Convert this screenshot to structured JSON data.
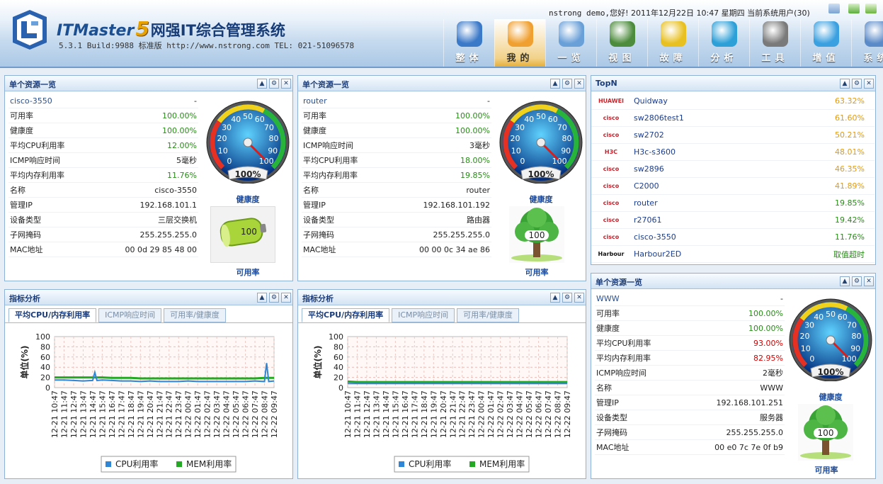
{
  "header": {
    "brand_en": "ITMaster",
    "brand_num": "5",
    "brand_cn": "网强IT综合管理系统",
    "version": "5.3.1 Build:9988",
    "edition": "标准版",
    "contact": "http://www.nstrong.com TEL: 021-51096578",
    "status_user": "nstrong demo,",
    "status_text": "您好! 2011年12月22日 10:47 星期四 当前系统用户(30)"
  },
  "nav": [
    {
      "label": "整体",
      "icon": "monitor-icon"
    },
    {
      "label": "我的",
      "icon": "user-icon",
      "active": true
    },
    {
      "label": "一览",
      "icon": "overview-icon"
    },
    {
      "label": "视图",
      "icon": "server-rack-icon"
    },
    {
      "label": "故障",
      "icon": "warning-icon"
    },
    {
      "label": "分析",
      "icon": "pie-chart-icon"
    },
    {
      "label": "工具",
      "icon": "tools-icon"
    },
    {
      "label": "增值",
      "icon": "plus-icon"
    },
    {
      "label": "系统",
      "icon": "system-icon"
    }
  ],
  "res1": {
    "title": "单个资源一览",
    "head_name": "cisco-3550",
    "head_val": "-",
    "rows": [
      {
        "k": "可用率",
        "v": "100.00%",
        "c": "g"
      },
      {
        "k": "健康度",
        "v": "100.00%",
        "c": "g"
      },
      {
        "k": "平均CPU利用率",
        "v": "12.00%",
        "c": "g"
      },
      {
        "k": "ICMP响应时间",
        "v": "5毫秒",
        "c": ""
      },
      {
        "k": "平均内存利用率",
        "v": "11.76%",
        "c": "g"
      },
      {
        "k": "名称",
        "v": "cisco-3550",
        "c": ""
      },
      {
        "k": "管理IP",
        "v": "192.168.101.1",
        "c": ""
      },
      {
        "k": "设备类型",
        "v": "三层交换机",
        "c": ""
      },
      {
        "k": "子网掩码",
        "v": "255.255.255.0",
        "c": ""
      },
      {
        "k": "MAC地址",
        "v": "00 0d 29 85 48 00",
        "c": ""
      }
    ],
    "gauge_value": 100,
    "gauge_readout": "100%",
    "gauge_caption": "健康度",
    "avail_value": "100",
    "avail_caption": "可用率"
  },
  "res2": {
    "title": "单个资源一览",
    "head_name": "router",
    "head_val": "-",
    "rows": [
      {
        "k": "可用率",
        "v": "100.00%",
        "c": "g"
      },
      {
        "k": "健康度",
        "v": "100.00%",
        "c": "g"
      },
      {
        "k": "ICMP响应时间",
        "v": "3毫秒",
        "c": ""
      },
      {
        "k": "平均CPU利用率",
        "v": "18.00%",
        "c": "g"
      },
      {
        "k": "平均内存利用率",
        "v": "19.85%",
        "c": "g"
      },
      {
        "k": "名称",
        "v": "router",
        "c": ""
      },
      {
        "k": "管理IP",
        "v": "192.168.101.192",
        "c": ""
      },
      {
        "k": "设备类型",
        "v": "路由器",
        "c": ""
      },
      {
        "k": "子网掩码",
        "v": "255.255.255.0",
        "c": ""
      },
      {
        "k": "MAC地址",
        "v": "00 00 0c 34 ae 86",
        "c": ""
      }
    ],
    "gauge_value": 100,
    "gauge_readout": "100%",
    "gauge_caption": "健康度",
    "avail_value": "100",
    "avail_caption": "可用率"
  },
  "res3": {
    "title": "单个资源一览",
    "head_name": "WWW",
    "head_val": "-",
    "rows": [
      {
        "k": "可用率",
        "v": "100.00%",
        "c": "g"
      },
      {
        "k": "健康度",
        "v": "100.00%",
        "c": "g"
      },
      {
        "k": "平均CPU利用率",
        "v": "93.00%",
        "c": "r"
      },
      {
        "k": "平均内存利用率",
        "v": "82.95%",
        "c": "r"
      },
      {
        "k": "ICMP响应时间",
        "v": "2毫秒",
        "c": ""
      },
      {
        "k": "名称",
        "v": "WWW",
        "c": ""
      },
      {
        "k": "管理IP",
        "v": "192.168.101.251",
        "c": ""
      },
      {
        "k": "设备类型",
        "v": "服务器",
        "c": ""
      },
      {
        "k": "子网掩码",
        "v": "255.255.255.0",
        "c": ""
      },
      {
        "k": "MAC地址",
        "v": "00 e0 7c 7e 0f b9",
        "c": ""
      }
    ],
    "gauge_value": 100,
    "gauge_readout": "100%",
    "gauge_caption": "健康度",
    "avail_value": "100",
    "avail_caption": "可用率"
  },
  "gauge_ticks": [
    "0",
    "10",
    "20",
    "30",
    "40",
    "50",
    "60",
    "70",
    "80",
    "90",
    "100"
  ],
  "topn": {
    "title": "TopN",
    "rows": [
      {
        "brand": "HUAWEI",
        "name": "Quidway",
        "value": "63.32%",
        "c": ""
      },
      {
        "brand": "cisco",
        "name": "sw2806test1",
        "value": "61.60%",
        "c": ""
      },
      {
        "brand": "cisco",
        "name": "sw2702",
        "value": "50.21%",
        "c": ""
      },
      {
        "brand": "H3C",
        "name": "H3c-s3600",
        "value": "48.01%",
        "c": ""
      },
      {
        "brand": "cisco",
        "name": "sw2896",
        "value": "46.35%",
        "c": ""
      },
      {
        "brand": "cisco",
        "name": "C2000",
        "value": "41.89%",
        "c": ""
      },
      {
        "brand": "cisco",
        "name": "router",
        "value": "19.85%",
        "c": "g"
      },
      {
        "brand": "cisco",
        "name": "r27061",
        "value": "19.42%",
        "c": "g"
      },
      {
        "brand": "cisco",
        "name": "cisco-3550",
        "value": "11.76%",
        "c": "g"
      },
      {
        "brand": "Harbour",
        "name": "Harbour2ED",
        "value": "取值超时",
        "c": "g"
      }
    ]
  },
  "analysis1": {
    "title": "指标分析",
    "tabs": [
      "平均CPU/内存利用率",
      "ICMP响应时间",
      "可用率/健康度"
    ]
  },
  "analysis2": {
    "title": "指标分析",
    "tabs": [
      "平均CPU/内存利用率",
      "ICMP响应时间",
      "可用率/健康度"
    ]
  },
  "chart_data": [
    {
      "type": "line",
      "ylabel": "单位(%)",
      "ylim": [
        0,
        100
      ],
      "yticks": [
        "0",
        "20",
        "40",
        "60",
        "80",
        "100"
      ],
      "grid": true,
      "legend": "bottom",
      "x": [
        "12-21 10:47",
        "12-21 11:47",
        "12-21 12:47",
        "12-21 13:47",
        "12-21 14:47",
        "12-21 15:47",
        "12-21 16:47",
        "12-21 17:47",
        "12-21 18:47",
        "12-21 19:47",
        "12-21 20:47",
        "12-21 21:47",
        "12-21 22:47",
        "12-21 23:47",
        "12-22 00:47",
        "12-22 01:47",
        "12-22 02:47",
        "12-22 03:47",
        "12-22 04:47",
        "12-22 05:47",
        "12-22 06:47",
        "12-22 07:47",
        "12-22 08:47",
        "12-22 09:47"
      ],
      "series": [
        {
          "name": "CPU利用率",
          "color": "#2f86d6",
          "values": [
            15,
            15,
            14,
            13,
            14,
            15,
            14,
            13,
            13,
            12,
            13,
            12,
            12,
            12,
            13,
            12,
            12,
            12,
            12,
            12,
            12,
            13,
            12,
            13
          ]
        },
        {
          "name": "MEM利用率",
          "color": "#23a923",
          "values": [
            20,
            20,
            20,
            20,
            20,
            20,
            19,
            19,
            19,
            18,
            18,
            18,
            18,
            18,
            18,
            18,
            18,
            18,
            18,
            18,
            18,
            18,
            19,
            19
          ]
        }
      ],
      "spikes": [
        {
          "series": 0,
          "index": 4,
          "value": 30
        },
        {
          "series": 0,
          "index": 22,
          "value": 48
        }
      ]
    },
    {
      "type": "line",
      "ylabel": "单位(%)",
      "ylim": [
        0,
        100
      ],
      "yticks": [
        "0",
        "20",
        "40",
        "60",
        "80",
        "100"
      ],
      "grid": true,
      "legend": "bottom",
      "x": [
        "12-21 10:47",
        "12-21 11:47",
        "12-21 12:47",
        "12-21 13:47",
        "12-21 14:47",
        "12-21 15:47",
        "12-21 16:47",
        "12-21 17:47",
        "12-21 18:47",
        "12-21 19:47",
        "12-21 20:47",
        "12-21 21:47",
        "12-21 22:47",
        "12-21 23:47",
        "12-22 00:47",
        "12-22 01:47",
        "12-22 02:47",
        "12-22 03:47",
        "12-22 04:47",
        "12-22 05:47",
        "12-22 06:47",
        "12-22 07:47",
        "12-22 08:47",
        "12-22 09:47"
      ],
      "series": [
        {
          "name": "CPU利用率",
          "color": "#2f86d6",
          "values": [
            8,
            8,
            8,
            8,
            8,
            8,
            8,
            8,
            8,
            8,
            8,
            8,
            8,
            8,
            8,
            8,
            8,
            8,
            8,
            8,
            8,
            8,
            8,
            8
          ]
        },
        {
          "name": "MEM利用率",
          "color": "#23a923",
          "values": [
            12,
            11,
            11,
            11,
            11,
            11,
            11,
            11,
            11,
            11,
            11,
            11,
            11,
            11,
            11,
            11,
            11,
            11,
            11,
            11,
            11,
            11,
            11,
            11
          ]
        }
      ],
      "spikes": []
    }
  ]
}
